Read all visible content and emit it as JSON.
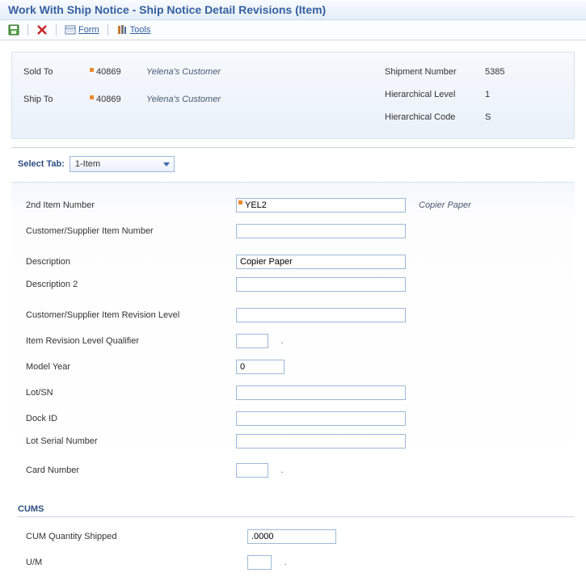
{
  "title": "Work With Ship Notice - Ship Notice Detail Revisions (Item)",
  "toolbar": {
    "form": "Form",
    "tools": "Tools"
  },
  "header": {
    "sold_to_label": "Sold To",
    "sold_to_value": "40869",
    "sold_to_desc": "Yelena's Customer",
    "ship_to_label": "Ship To",
    "ship_to_value": "40869",
    "ship_to_desc": "Yelena's Customer",
    "shipment_number_label": "Shipment Number",
    "shipment_number_value": "5385",
    "hier_level_label": "Hierarchical Level",
    "hier_level_value": "1",
    "hier_code_label": "Hierarchical Code",
    "hier_code_value": "S"
  },
  "tab": {
    "label": "Select Tab:",
    "selected": "1-Item"
  },
  "fields": {
    "second_item_number_label": "2nd Item Number",
    "second_item_number_value": "YEL2",
    "second_item_number_desc": "Copier Paper",
    "cust_supp_item_label": "Customer/Supplier Item Number",
    "cust_supp_item_value": "",
    "description_label": "Description",
    "description_value": "Copier Paper",
    "description2_label": "Description 2",
    "description2_value": "",
    "rev_level_label": "Customer/Supplier Item Revision Level",
    "rev_level_value": "",
    "rev_qual_label": "Item Revision Level Qualifier",
    "rev_qual_value": "",
    "rev_qual_desc": ".",
    "model_year_label": "Model Year",
    "model_year_value": "0",
    "lot_sn_label": "Lot/SN",
    "lot_sn_value": "",
    "dock_id_label": "Dock ID",
    "dock_id_value": "",
    "lot_serial_label": "Lot Serial Number",
    "lot_serial_value": "",
    "card_number_label": "Card Number",
    "card_number_value": "",
    "card_number_desc": "."
  },
  "cums": {
    "title": "CUMS",
    "qty_label": "CUM Quantity Shipped",
    "qty_value": ".0000",
    "um_label": "U/M",
    "um_value": "",
    "um_desc": "."
  }
}
